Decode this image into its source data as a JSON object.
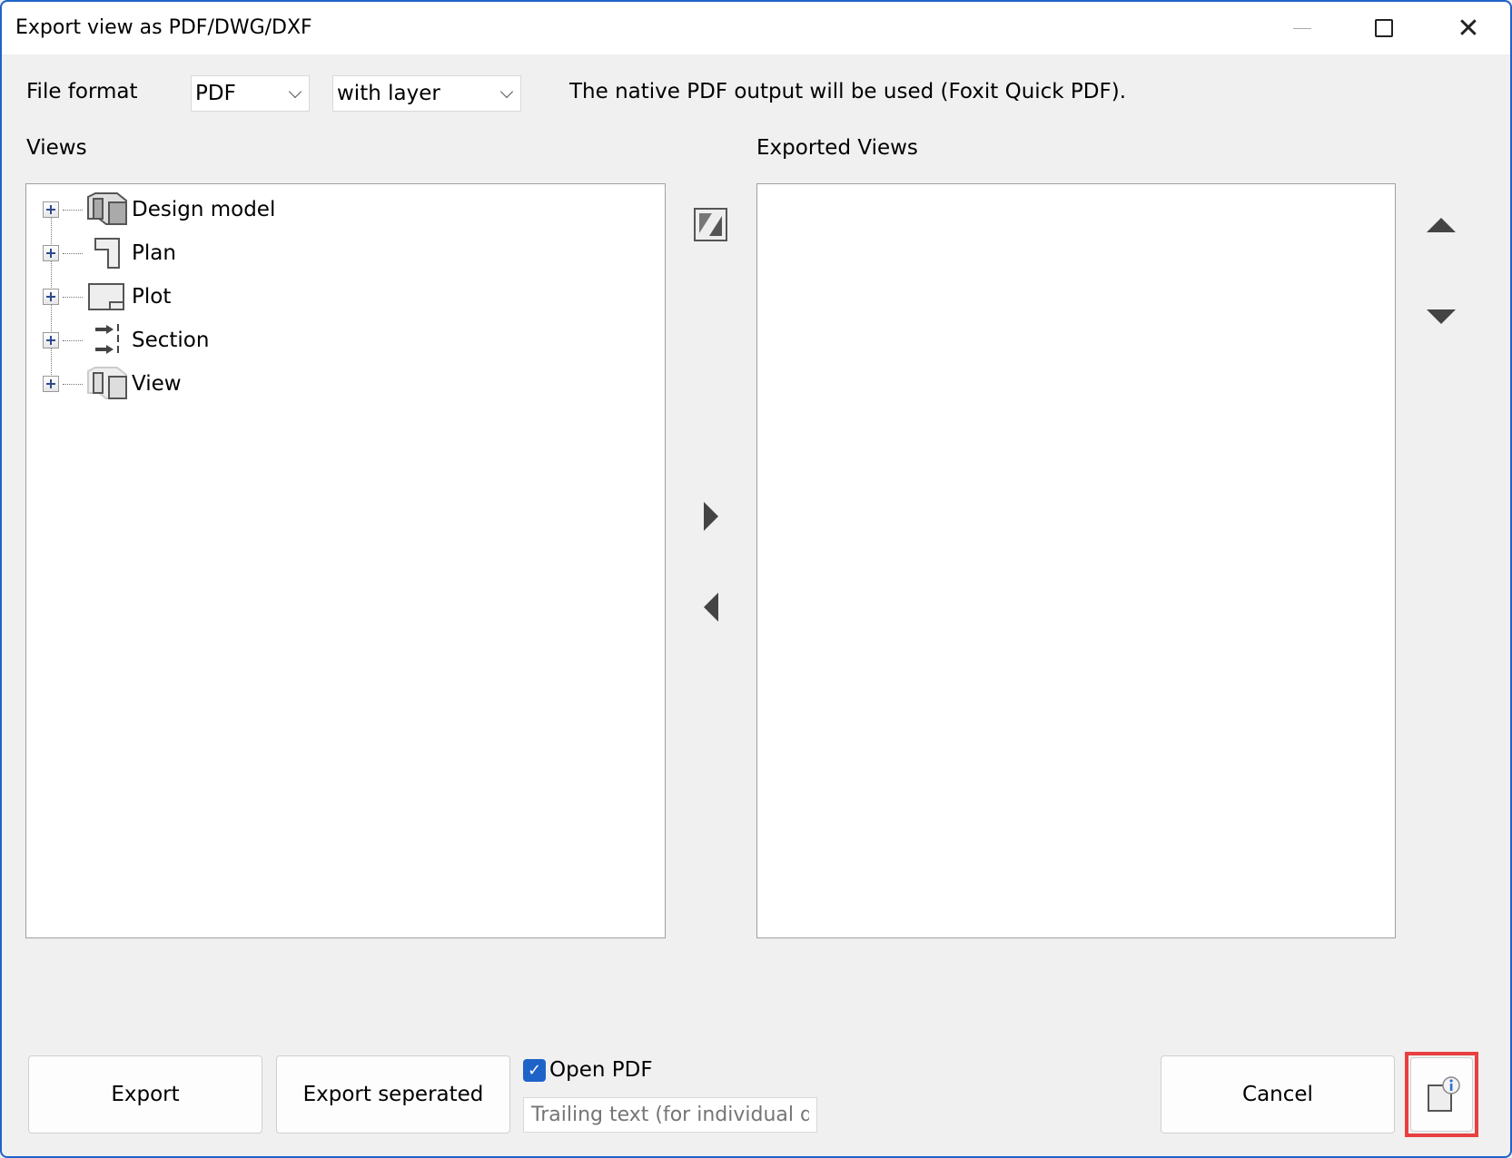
{
  "window": {
    "title": "Export view as PDF/DWG/DXF"
  },
  "file_format": {
    "label": "File format",
    "format": "PDF",
    "layer_option": "with layer",
    "info": "The native PDF output will be used (Foxit Quick PDF)."
  },
  "views": {
    "label": "Views",
    "items": [
      {
        "label": "Design model",
        "icon": "design-model-icon"
      },
      {
        "label": "Plan",
        "icon": "plan-icon"
      },
      {
        "label": "Plot",
        "icon": "plot-icon"
      },
      {
        "label": "Section",
        "icon": "section-icon"
      },
      {
        "label": "View",
        "icon": "view-icon"
      }
    ]
  },
  "exported": {
    "label": "Exported Views"
  },
  "footer": {
    "export": "Export",
    "export_separated": "Export seperated",
    "open_pdf": "Open PDF",
    "open_pdf_checked": true,
    "trailing_placeholder": "Trailing text (for individual da",
    "cancel": "Cancel"
  },
  "colors": {
    "accent": "#1e63c8",
    "highlight": "#e84040"
  }
}
